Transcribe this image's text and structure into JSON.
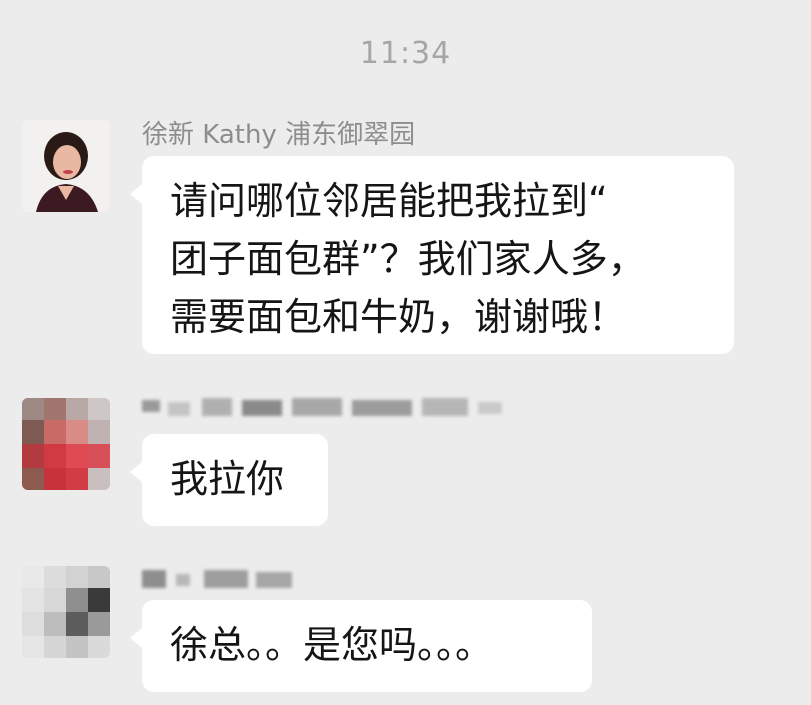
{
  "chat": {
    "timestamp": "11:34",
    "messages": [
      {
        "sender": "徐新 Kathy 浦东御翠园",
        "text": "请问哪位邻居能把我拉到“\n团子面包群”？我们家人多，\n需要面包和牛奶，谢谢哦！",
        "avatar": "woman-portrait-avatar"
      },
      {
        "sender": "",
        "text": "我拉你",
        "avatar": "blurred-avatar-red"
      },
      {
        "sender": "",
        "text": "徐总。。是您吗。。。",
        "avatar": "blurred-avatar-gray"
      }
    ]
  }
}
